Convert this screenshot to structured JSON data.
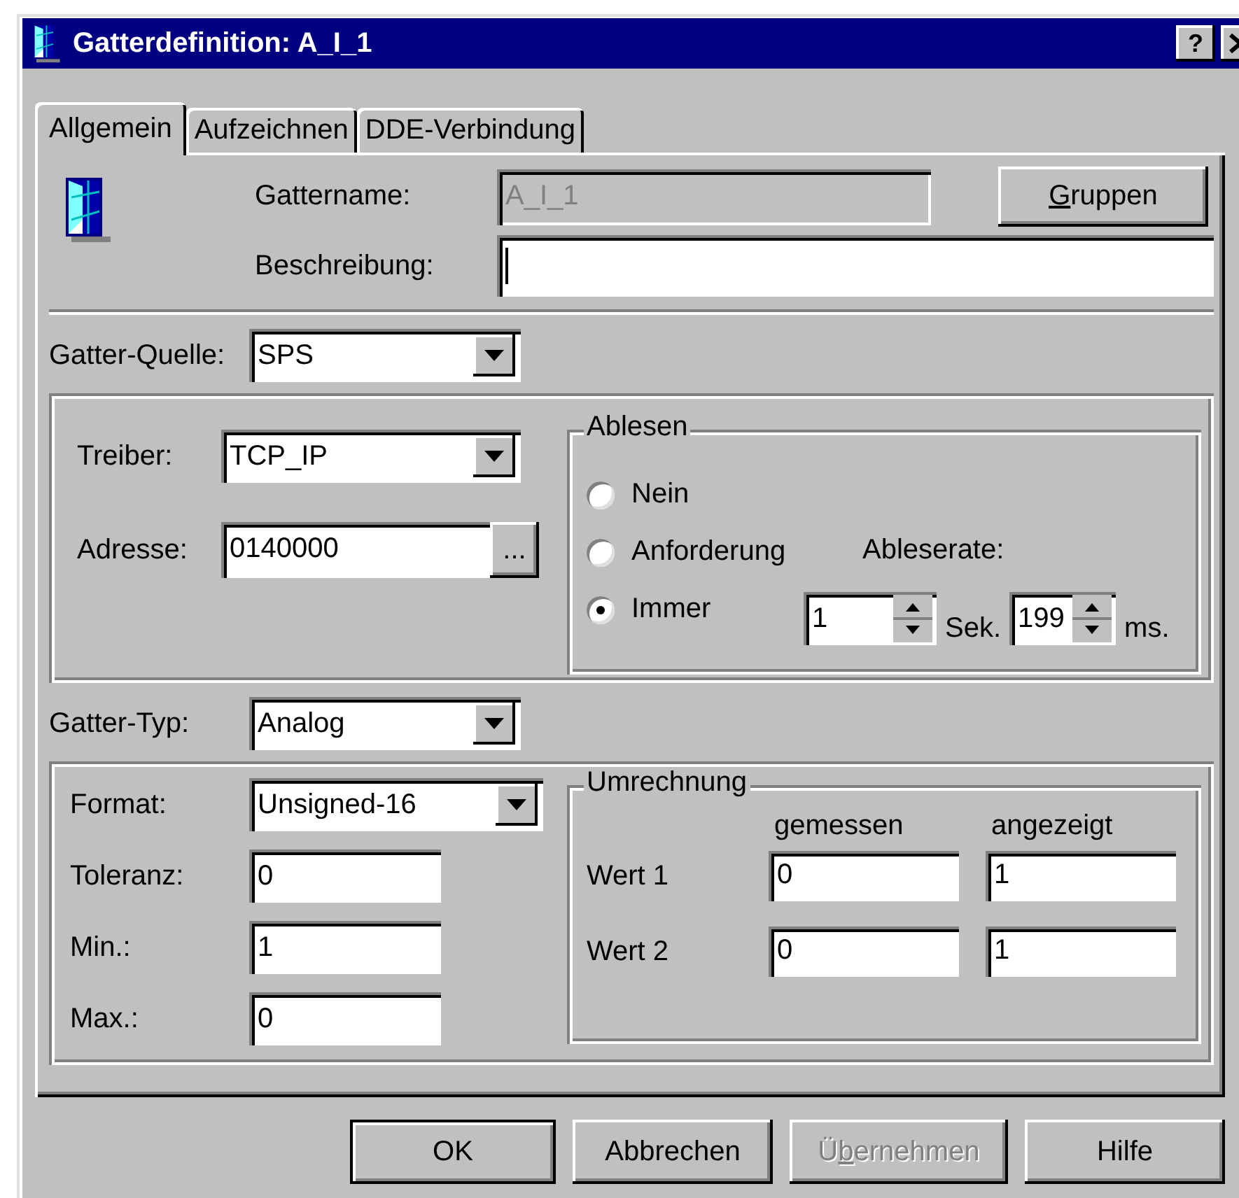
{
  "window": {
    "title": "Gatterdefinition: A_I_1",
    "help_button": "?"
  },
  "tabs": [
    {
      "label": "Allgemein",
      "selected": true
    },
    {
      "label": "Aufzeichnen",
      "selected": false
    },
    {
      "label": "DDE-Verbindung",
      "selected": false
    }
  ],
  "gate_name": {
    "label": "Gattername:",
    "value": "A_I_1",
    "disabled": true
  },
  "groups_button": {
    "label_parts": [
      {
        "text": "G",
        "underlined": true
      },
      {
        "text": "ruppen",
        "underlined": false
      }
    ]
  },
  "description": {
    "label": "Beschreibung:",
    "focused": true
  },
  "source": {
    "label": "Gatter-Quelle:",
    "value": "SPS"
  },
  "driver": {
    "label": "Treiber:",
    "value": "TCP_IP"
  },
  "address": {
    "label": "Adresse:",
    "value": "0140000",
    "browse_button": "..."
  },
  "reading": {
    "title": "Ablesen",
    "options": [
      {
        "label": "Nein",
        "selected": false
      },
      {
        "label": "Anforderung",
        "selected": false
      },
      {
        "label": "Immer",
        "selected": true
      }
    ],
    "rate_label": "Ableserate:",
    "seconds": {
      "value": "1",
      "unit": "Sek."
    },
    "milliseconds": {
      "value": "199",
      "unit": "ms."
    }
  },
  "gate_type": {
    "label": "Gatter-Typ:",
    "value": "Analog"
  },
  "format": {
    "label": "Format:",
    "value": "Unsigned-16"
  },
  "limits": [
    {
      "label": "Toleranz:",
      "value": "0"
    },
    {
      "label": "Min.:",
      "value": "1"
    },
    {
      "label": "Max.:",
      "value": "0"
    }
  ],
  "conversion": {
    "title": "Umrechnung",
    "columns": [
      "gemessen",
      "angezeigt"
    ],
    "rows": [
      {
        "label": "Wert 1",
        "values": [
          "0",
          "1"
        ]
      },
      {
        "label": "Wert 2",
        "values": [
          "0",
          "1"
        ]
      }
    ]
  },
  "buttons": [
    {
      "label": "OK",
      "default": true,
      "disabled": false
    },
    {
      "label": "Abbrechen",
      "default": false,
      "disabled": false
    },
    {
      "label_parts": [
        {
          "text": "Ü",
          "underlined": false
        },
        {
          "text": "b",
          "underlined": true
        },
        {
          "text": "ernehmen",
          "underlined": false
        }
      ],
      "default": false,
      "disabled": true
    },
    {
      "label": "Hilfe",
      "default": false,
      "disabled": false
    }
  ]
}
